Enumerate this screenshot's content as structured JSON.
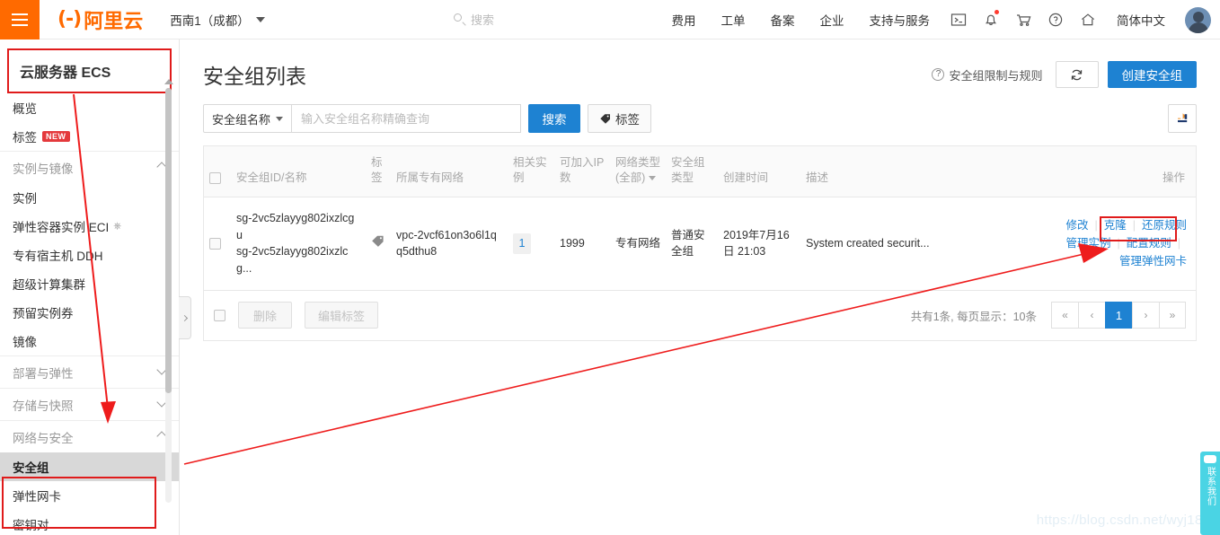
{
  "topbar": {
    "menu_icon": "hamburger-icon",
    "brand_mark": "(-)",
    "brand_text": "阿里云",
    "region": "西南1（成都）",
    "search_placeholder": "搜索",
    "nav": [
      {
        "label": "费用"
      },
      {
        "label": "工单"
      },
      {
        "label": "备案"
      },
      {
        "label": "企业"
      },
      {
        "label": "支持与服务"
      }
    ],
    "icons": [
      {
        "name": "terminal-icon"
      },
      {
        "name": "bell-icon",
        "has_dot": true
      },
      {
        "name": "cart-icon"
      },
      {
        "name": "question-icon"
      },
      {
        "name": "home-icon"
      }
    ],
    "language": "简体中文",
    "avatar": "user-avatar"
  },
  "sidebar": {
    "product_title": "云服务器 ECS",
    "items": [
      {
        "label": "概览",
        "type": "item"
      },
      {
        "label": "标签",
        "type": "item",
        "badge": "NEW"
      },
      {
        "label": "实例与镜像",
        "type": "group",
        "expanded": true
      },
      {
        "label": "实例",
        "type": "item"
      },
      {
        "label": "弹性容器实例 ECI",
        "type": "item",
        "external": true
      },
      {
        "label": "专有宿主机 DDH",
        "type": "item"
      },
      {
        "label": "超级计算集群",
        "type": "item"
      },
      {
        "label": "预留实例券",
        "type": "item"
      },
      {
        "label": "镜像",
        "type": "item"
      },
      {
        "label": "部署与弹性",
        "type": "group",
        "expanded": false
      },
      {
        "label": "存储与快照",
        "type": "group",
        "expanded": false
      },
      {
        "label": "网络与安全",
        "type": "group",
        "expanded": true
      },
      {
        "label": "安全组",
        "type": "item",
        "active": true
      },
      {
        "label": "弹性网卡",
        "type": "item"
      },
      {
        "label": "密钥对",
        "type": "item"
      }
    ]
  },
  "main": {
    "page_title": "安全组列表",
    "help_link": "安全组限制与规则",
    "refresh_icon": "refresh-icon",
    "create_button": "创建安全组",
    "filter": {
      "select_value": "安全组名称",
      "input_value": "",
      "input_placeholder": "输入安全组名称精确查询",
      "search_button": "搜索",
      "tag_button": "标签",
      "tag_icon": "tag-icon",
      "export_icon": "export-icon"
    },
    "table": {
      "columns": [
        "安全组ID/名称",
        "标签",
        "所属专有网络",
        "相关实例",
        "可加入IP数",
        "网络类型(全部)",
        "安全组类型",
        "创建时间",
        "描述",
        "操作"
      ],
      "rows": [
        {
          "sg_id": "sg-2vc5zlayyg802ixzlcgu",
          "sg_name": "sg-2vc5zlayyg802ixzlcg...",
          "tag_icon": "tag-icon",
          "vpc": "vpc-2vcf61on3o6l1qq5dthu8",
          "instances": "1",
          "ip_count": "1999",
          "net_type": "专有网络",
          "sg_type": "普通安全组",
          "created": "2019年7月16日 21:03",
          "description": "System created securit...",
          "actions": [
            "修改",
            "克隆",
            "还原规则",
            "管理实例",
            "配置规则",
            "管理弹性网卡"
          ]
        }
      ]
    },
    "footer": {
      "delete_button": "删除",
      "edit_tag_button": "编辑标签",
      "total_text": "共有1条, 每页显示：10条",
      "pager": [
        "«",
        "‹",
        "1",
        "›",
        "»"
      ],
      "current_page": "1"
    }
  },
  "overlay": {
    "watermark": "https://blog.csdn.net/wyj18...",
    "contact_tab": "联系我们",
    "highlight_color": "#e01b1b",
    "accent_color": "#1e82d2",
    "brand_color": "#ff6a00"
  }
}
